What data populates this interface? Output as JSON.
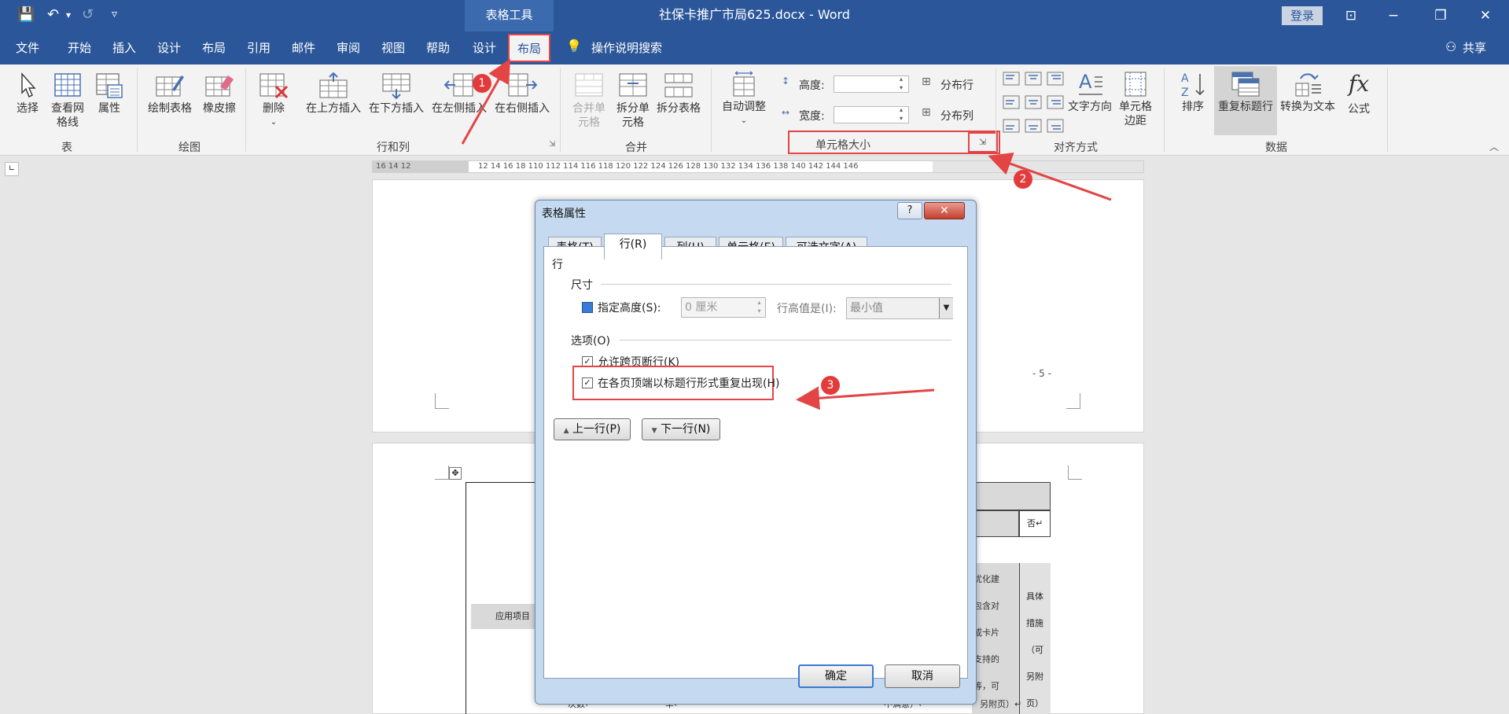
{
  "window": {
    "doc_title": "社保卡推广市局625.docx - Word",
    "context_tab": "表格工具",
    "login": "登录",
    "share": "共享",
    "icons": {
      "save": "💾",
      "undo": "↶",
      "undo_more": "▾",
      "redo": "↺",
      "customize": "▿",
      "ribbon_display": "⊡",
      "minimize": "−",
      "restore": "❐",
      "close": "✕",
      "share": "⚇",
      "search": "💡"
    }
  },
  "menu": {
    "items": [
      "文件",
      "开始",
      "插入",
      "设计",
      "布局",
      "引用",
      "邮件",
      "审阅",
      "视图",
      "帮助",
      "设计"
    ],
    "active": "布局",
    "search": "操作说明搜索"
  },
  "ribbon": {
    "table": {
      "select": "选择",
      "view_grid": "查看网格线",
      "properties": "属性",
      "group": "表"
    },
    "draw": {
      "draw_table": "绘制表格",
      "eraser": "橡皮擦",
      "group": "绘图"
    },
    "rows_cols": {
      "delete": "删除",
      "insert_above": "在上方插入",
      "insert_below": "在下方插入",
      "insert_left": "在左侧插入",
      "insert_right": "在右侧插入",
      "group": "行和列"
    },
    "merge": {
      "merge_cells": "合并单元格",
      "split_cells": "拆分单元格",
      "split_table": "拆分表格",
      "group": "合并"
    },
    "cell_size": {
      "autofit": "自动调整",
      "height_label": "高度:",
      "width_label": "宽度:",
      "distribute_rows": "分布行",
      "distribute_cols": "分布列",
      "group": "单元格大小"
    },
    "alignment": {
      "text_direction": "文字方向",
      "cell_margins": "单元格边距",
      "group": "对齐方式"
    },
    "data": {
      "sort": "排序",
      "repeat_header": "重复标题行",
      "convert_text": "转换为文本",
      "formula": "公式",
      "group": "数据"
    }
  },
  "ruler": {
    "left": "16  14  12",
    "mid": "12  14  16  18  110  112  114  116  118  120  122  124  126  128  130  132  134  136  138  140  142  144  146"
  },
  "document": {
    "page_num": "- 5 -",
    "col_cells": [
      "否↵",
      "具体",
      "措施",
      "（可",
      "另附",
      "页）↵"
    ],
    "left_cell": "应用项目",
    "bottom": [
      "次数↵",
      "率↵",
      "不满意）↵",
      "另附页）↵"
    ],
    "partial": [
      "优化建",
      "包含对",
      "或卡片",
      "支持的",
      "等，可"
    ]
  },
  "dialog": {
    "title": "表格属性",
    "help": "?",
    "close": "✕",
    "tabs": [
      "表格(T)",
      "行(R)",
      "列(U)",
      "单元格(E)",
      "可选文字(A)"
    ],
    "active_tab": "行(R)",
    "section_row": "行",
    "size_label": "尺寸",
    "specify_height": "指定高度(S):",
    "height_value": "0 厘米",
    "row_height_is": "行高值是(I):",
    "row_height_mode": "最小值",
    "options_label": "选项(O)",
    "allow_break": "允许跨页断行(K)",
    "repeat_header": "在各页顶端以标题行形式重复出现(H)",
    "check": "✓",
    "prev_row": "上一行(P)",
    "next_row": "下一行(N)",
    "prev_icon": "▲",
    "next_icon": "▼",
    "ok": "确定",
    "cancel": "取消"
  },
  "annotations": {
    "step1": "1",
    "step2": "2",
    "step3": "3"
  },
  "colors": {
    "word_blue": "#2b579a",
    "annotation_red": "#e34545",
    "ribbon_bg": "#f3f3f3"
  }
}
